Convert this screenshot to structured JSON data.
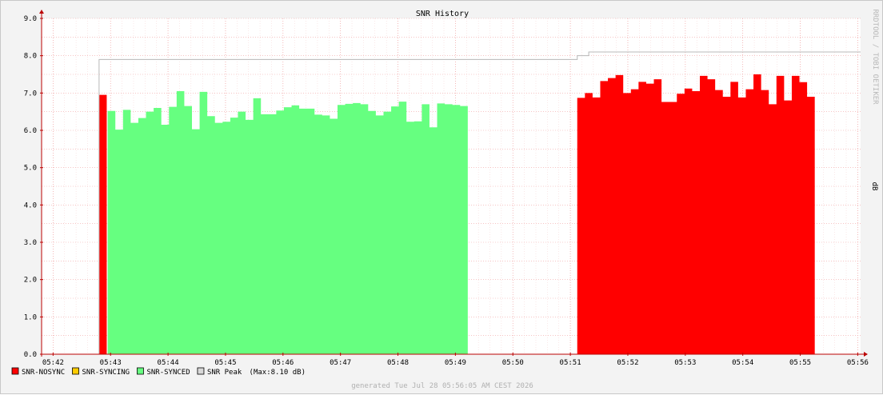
{
  "chart_data": {
    "type": "area",
    "title": "SNR History",
    "ylabel": "dB",
    "watermark": "RRDTOOL / TOBI OETIKER",
    "footer": "generated Tue Jul 28 05:56:05 AM CEST 2026",
    "ylim": [
      0,
      9
    ],
    "y_ticks": [
      "0.0",
      "1.0",
      "2.0",
      "3.0",
      "4.0",
      "5.0",
      "6.0",
      "7.0",
      "8.0",
      "9.0"
    ],
    "x_ticks": [
      "05:42",
      "05:43",
      "05:44",
      "05:45",
      "05:46",
      "05:47",
      "05:48",
      "05:49",
      "05:50",
      "05:51",
      "05:52",
      "05:53",
      "05:54",
      "05:55",
      "05:56"
    ],
    "x_range_minutes": [
      -0.2,
      14.05
    ],
    "grid": true,
    "legend_position": "bottom-left",
    "legend": [
      {
        "name": "SNR-NOSYNC",
        "color": "#ff0000"
      },
      {
        "name": "SNR-SYNCING",
        "color": "#ffcc00"
      },
      {
        "name": "SNR-SYNCED",
        "color": "#66ff80"
      },
      {
        "name": "SNR Peak",
        "color": "#d8d8d8",
        "note": "(Max:8.10 dB)"
      }
    ],
    "colors": {
      "nosync": "#ff0000",
      "syncing": "#ffcc00",
      "synced": "#66ff80",
      "peak_line": "#b8b8b8",
      "grid": "#f0a0a0",
      "axis": "#bb0000"
    },
    "sample_interval_minutes": 0.1333,
    "series": [
      {
        "name": "SNR-NOSYNC",
        "start_minute": 0.8,
        "values": [
          6.95
        ]
      },
      {
        "name": "SNR-SYNCED",
        "start_minute": 0.95,
        "values": [
          6.52,
          6.02,
          6.55,
          6.2,
          6.33,
          6.5,
          6.6,
          6.15,
          6.63,
          7.05,
          6.65,
          6.03,
          7.03,
          6.38,
          6.2,
          6.23,
          6.34,
          6.5,
          6.28,
          6.86,
          6.43,
          6.43,
          6.53,
          6.62,
          6.67,
          6.58,
          6.58,
          6.42,
          6.4,
          6.31,
          6.68,
          6.71,
          6.73,
          6.7,
          6.52,
          6.4,
          6.5,
          6.64,
          6.77,
          6.23,
          6.24,
          6.7,
          6.08,
          6.72,
          6.7,
          6.68,
          6.65
        ]
      },
      {
        "name": "SNR-NOSYNC",
        "start_minute": 9.12,
        "values": [
          6.87,
          7.0,
          6.88,
          7.32,
          7.4,
          7.48,
          7.0,
          7.1,
          7.3,
          7.25,
          7.37,
          6.76,
          6.76,
          6.98,
          7.12,
          7.05,
          7.46,
          7.37,
          7.08,
          6.9,
          7.3,
          6.88,
          7.1,
          7.5,
          7.08,
          6.7,
          7.46,
          6.8,
          7.46,
          7.29,
          6.9
        ]
      },
      {
        "name": "SNR Peak",
        "points": [
          [
            0.8,
            0
          ],
          [
            0.8,
            7.9
          ],
          [
            9.12,
            7.9
          ],
          [
            9.12,
            8.0
          ],
          [
            9.32,
            8.0
          ],
          [
            9.32,
            8.1
          ],
          [
            14.05,
            8.1
          ]
        ]
      }
    ]
  }
}
